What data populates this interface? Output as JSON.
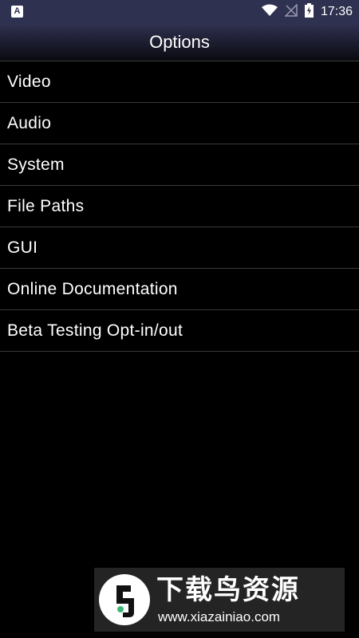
{
  "status_bar": {
    "notification_icon": "A",
    "time": "17:36",
    "icons": [
      "wifi-icon",
      "no-signal-icon",
      "battery-charging-icon"
    ]
  },
  "header": {
    "title": "Options"
  },
  "menu": {
    "items": [
      {
        "label": "Video"
      },
      {
        "label": "Audio"
      },
      {
        "label": "System"
      },
      {
        "label": "File Paths"
      },
      {
        "label": "GUI"
      },
      {
        "label": "Online Documentation"
      },
      {
        "label": "Beta Testing Opt-in/out"
      }
    ]
  },
  "watermark": {
    "title": "下载鸟资源",
    "url": "www.xiazainiao.com"
  },
  "colors": {
    "background": "#000000",
    "status_bar": "#2f3150",
    "divider": "#3a3a3a",
    "text": "#ffffff"
  }
}
